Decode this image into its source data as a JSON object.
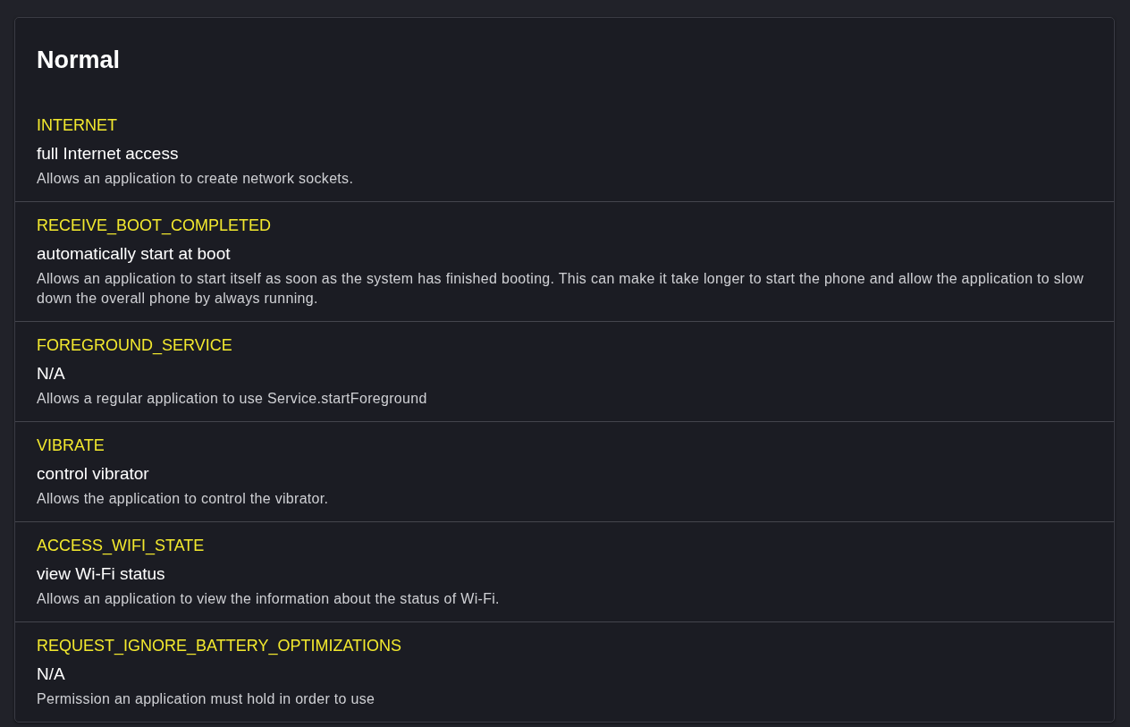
{
  "section": {
    "title": "Normal",
    "permissions": [
      {
        "name": "INTERNET",
        "label": "full Internet access",
        "description": "Allows an application to create network sockets."
      },
      {
        "name": "RECEIVE_BOOT_COMPLETED",
        "label": "automatically start at boot",
        "description": "Allows an application to start itself as soon as the system has finished booting. This can make it take longer to start the phone and allow the application to slow down the overall phone by always running."
      },
      {
        "name": "FOREGROUND_SERVICE",
        "label": "N/A",
        "description": "Allows a regular application to use Service.startForeground"
      },
      {
        "name": "VIBRATE",
        "label": "control vibrator",
        "description": "Allows the application to control the vibrator."
      },
      {
        "name": "ACCESS_WIFI_STATE",
        "label": "view Wi-Fi status",
        "description": "Allows an application to view the information about the status of Wi-Fi."
      },
      {
        "name": "REQUEST_IGNORE_BATTERY_OPTIMIZATIONS",
        "label": "N/A",
        "description": "Permission an application must hold in order to use"
      }
    ]
  }
}
